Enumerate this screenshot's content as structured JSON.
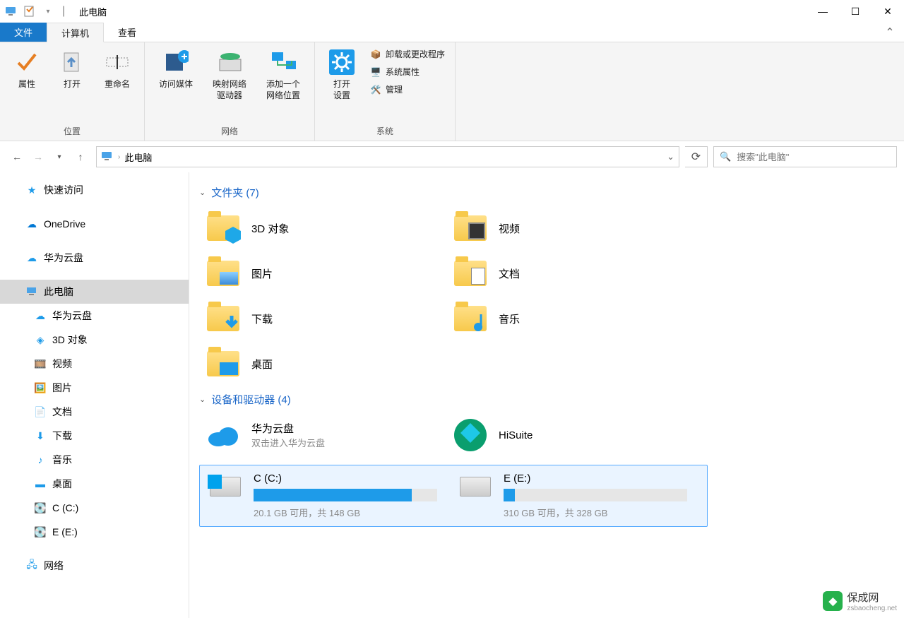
{
  "window": {
    "title": "此电脑"
  },
  "tabs": {
    "file": "文件",
    "computer": "计算机",
    "view": "查看"
  },
  "ribbon": {
    "group_location": "位置",
    "group_network": "网络",
    "group_system": "系统",
    "properties": "属性",
    "open": "打开",
    "rename": "重命名",
    "access_media": "访问媒体",
    "map_drive": "映射网络\n驱动器",
    "add_netloc": "添加一个\n网络位置",
    "open_settings": "打开\n设置",
    "uninstall": "卸载或更改程序",
    "sysprops": "系统属性",
    "manage": "管理"
  },
  "address": {
    "location": "此电脑"
  },
  "search": {
    "placeholder": "搜索\"此电脑\""
  },
  "nav": {
    "quick": "快速访问",
    "onedrive": "OneDrive",
    "huawei": "华为云盘",
    "thispc": "此电脑",
    "sub_huawei": "华为云盘",
    "sub_3d": "3D 对象",
    "sub_video": "视频",
    "sub_pic": "图片",
    "sub_doc": "文档",
    "sub_dl": "下载",
    "sub_music": "音乐",
    "sub_desktop": "桌面",
    "sub_c": "C (C:)",
    "sub_e": "E  (E:)",
    "network": "网络"
  },
  "groups": {
    "folders": "文件夹 (7)",
    "drives": "设备和驱动器 (4)"
  },
  "folders": {
    "3d": "3D 对象",
    "video": "视频",
    "pic": "图片",
    "doc": "文档",
    "dl": "下载",
    "music": "音乐",
    "desktop": "桌面"
  },
  "drives": {
    "hw_name": "华为云盘",
    "hw_sub": "双击进入华为云盘",
    "hs_name": "HiSuite",
    "c_name": "C (C:)",
    "c_sub": "20.1 GB 可用，共 148 GB",
    "c_pct": 86,
    "e_name": "E  (E:)",
    "e_sub": "310 GB 可用，共 328 GB",
    "e_pct": 6
  },
  "watermark": {
    "name": "保成网",
    "sub": "zsbaocheng.net"
  }
}
